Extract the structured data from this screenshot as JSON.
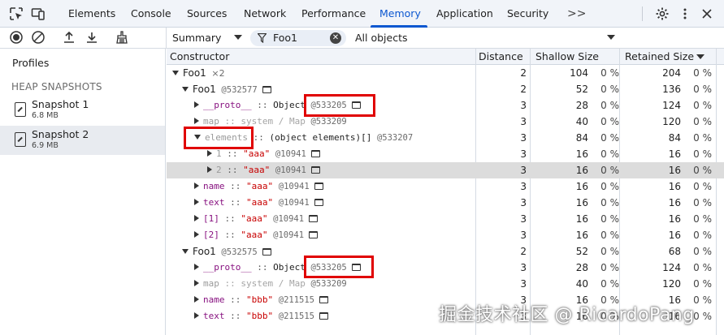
{
  "tabs": [
    {
      "label": "Elements",
      "active": false
    },
    {
      "label": "Console",
      "active": false
    },
    {
      "label": "Sources",
      "active": false
    },
    {
      "label": "Network",
      "active": false
    },
    {
      "label": "Performance",
      "active": false
    },
    {
      "label": "Memory",
      "active": true
    },
    {
      "label": "Application",
      "active": false
    },
    {
      "label": "Security",
      "active": false
    }
  ],
  "more_tabs": ">>",
  "toolbar": {
    "view_select": "Summary",
    "filter_value": "Foo1",
    "objects_select": "All objects"
  },
  "sidebar": {
    "profiles_label": "Profiles",
    "section_heading": "HEAP SNAPSHOTS",
    "snapshots": [
      {
        "name": "Snapshot 1",
        "size": "6.8 MB",
        "selected": false
      },
      {
        "name": "Snapshot 2",
        "size": "6.9 MB",
        "selected": true
      }
    ]
  },
  "columns": {
    "constructor": "Constructor",
    "distance": "Distance",
    "shallow": "Shallow Size",
    "retained": "Retained Size"
  },
  "rows": [
    {
      "name": "Foo1",
      "count": "×2",
      "distance": "2",
      "shallow": "104",
      "shallow_pct": "0 %",
      "retained": "204",
      "retained_pct": "0 %"
    },
    {
      "name": "Foo1",
      "addr": "@532577",
      "distance": "2",
      "shallow": "52",
      "shallow_pct": "0 %",
      "retained": "136",
      "retained_pct": "0 %"
    },
    {
      "prop": "__proto__",
      "sep": " :: ",
      "type": "Object",
      "addr": "@533205",
      "distance": "3",
      "shallow": "28",
      "shallow_pct": "0 %",
      "retained": "124",
      "retained_pct": "0 %"
    },
    {
      "prop": "map",
      "sep": " :: ",
      "type": "system / Map",
      "addr": "@533209",
      "distance": "3",
      "shallow": "40",
      "shallow_pct": "0 %",
      "retained": "120",
      "retained_pct": "0 %"
    },
    {
      "prop": "elements",
      "sep": " :: ",
      "type": "(object elements)[]",
      "addr": "@533207",
      "distance": "3",
      "shallow": "84",
      "shallow_pct": "0 %",
      "retained": "84",
      "retained_pct": "0 %"
    },
    {
      "prop": "1",
      "sep": " :: ",
      "value": "\"aaa\"",
      "addr": "@10941",
      "distance": "3",
      "shallow": "16",
      "shallow_pct": "0 %",
      "retained": "16",
      "retained_pct": "0 %"
    },
    {
      "prop": "2",
      "sep": " :: ",
      "value": "\"aaa\"",
      "addr": "@10941",
      "distance": "3",
      "shallow": "16",
      "shallow_pct": "0 %",
      "retained": "16",
      "retained_pct": "0 %"
    },
    {
      "prop": "name",
      "sep": " :: ",
      "value": "\"aaa\"",
      "addr": "@10941",
      "distance": "3",
      "shallow": "16",
      "shallow_pct": "0 %",
      "retained": "16",
      "retained_pct": "0 %"
    },
    {
      "prop": "text",
      "sep": " :: ",
      "value": "\"aaa\"",
      "addr": "@10941",
      "distance": "3",
      "shallow": "16",
      "shallow_pct": "0 %",
      "retained": "16",
      "retained_pct": "0 %"
    },
    {
      "prop": "[1]",
      "sep": " :: ",
      "value": "\"aaa\"",
      "addr": "@10941",
      "distance": "3",
      "shallow": "16",
      "shallow_pct": "0 %",
      "retained": "16",
      "retained_pct": "0 %"
    },
    {
      "prop": "[2]",
      "sep": " :: ",
      "value": "\"aaa\"",
      "addr": "@10941",
      "distance": "3",
      "shallow": "16",
      "shallow_pct": "0 %",
      "retained": "16",
      "retained_pct": "0 %"
    },
    {
      "name": "Foo1",
      "addr": "@532575",
      "distance": "2",
      "shallow": "52",
      "shallow_pct": "0 %",
      "retained": "68",
      "retained_pct": "0 %"
    },
    {
      "prop": "__proto__",
      "sep": " :: ",
      "type": "Object",
      "addr": "@533205",
      "distance": "3",
      "shallow": "28",
      "shallow_pct": "0 %",
      "retained": "124",
      "retained_pct": "0 %"
    },
    {
      "prop": "map",
      "sep": " :: ",
      "type": "system / Map",
      "addr": "@533209",
      "distance": "3",
      "shallow": "40",
      "shallow_pct": "0 %",
      "retained": "120",
      "retained_pct": "0 %"
    },
    {
      "prop": "name",
      "sep": " :: ",
      "value": "\"bbb\"",
      "addr": "@211515",
      "distance": "3",
      "shallow": "16",
      "shallow_pct": "0 %",
      "retained": "16",
      "retained_pct": "0 %"
    },
    {
      "prop": "text",
      "sep": " :: ",
      "value": "\"bbb\"",
      "addr": "@211515",
      "distance": "3",
      "shallow": "16",
      "shallow_pct": "0 %",
      "retained": "16",
      "retained_pct": "0 %"
    }
  ],
  "watermark": "掘金技术社区 @ RicardoPang",
  "colors": {
    "accent": "#0b57d0",
    "highlight_box": "#e00000",
    "property": "#881280",
    "string": "#c80000"
  }
}
